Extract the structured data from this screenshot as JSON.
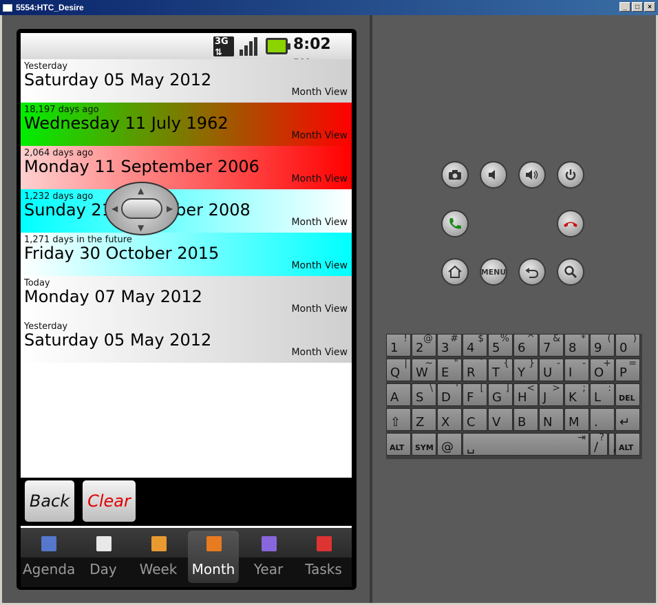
{
  "window": {
    "title": "5554:HTC_Desire",
    "btn_min": "_",
    "btn_max": "□",
    "btn_close": "×"
  },
  "status": {
    "network": "3G",
    "time": "8:02",
    "ampm": "PM"
  },
  "rows": [
    {
      "sub": "Yesterday",
      "date": "Saturday 05 May 2012",
      "link": "Month View",
      "bg": "linear-gradient(to right,#ffffff,#cfcfcf)"
    },
    {
      "sub": "18,197 days ago",
      "date": "Wednesday 11 July 1962",
      "link": "Month View",
      "bg": "linear-gradient(to right,#00ee00,#ff0000)"
    },
    {
      "sub": "2,064 days ago",
      "date": "Monday 11 September 2006",
      "link": "Month View",
      "bg": "linear-gradient(to right,#ffd0d0,#ff0000)"
    },
    {
      "sub": "1,232 days ago",
      "date": "Sunday 21 December 2008",
      "link": "Month View",
      "bg": "linear-gradient(to right,#00ffff,#ffffff)"
    },
    {
      "sub": "1,271 days in the future",
      "date": "Friday 30 October 2015",
      "link": "Month View",
      "bg": "linear-gradient(to right,#ffffff,#00ffff)"
    },
    {
      "sub": "Today",
      "date": "Monday 07 May 2012",
      "link": "Month View",
      "bg": "linear-gradient(to right,#ffffff,#cfcfcf)"
    },
    {
      "sub": "Yesterday",
      "date": "Saturday 05 May 2012",
      "link": "Month View",
      "bg": "linear-gradient(to right,#ffffff,#cfcfcf)"
    }
  ],
  "buttons": {
    "back": "Back",
    "clear": "Clear"
  },
  "tabs": [
    {
      "label": "Agenda",
      "icon": "agenda-icon",
      "color": "#5577cc"
    },
    {
      "label": "Day",
      "icon": "day-icon",
      "color": "#e8e8e8"
    },
    {
      "label": "Week",
      "icon": "week-icon",
      "color": "#e89a30"
    },
    {
      "label": "Month",
      "icon": "month-icon",
      "color": "#e87a20"
    },
    {
      "label": "Year",
      "icon": "year-icon",
      "color": "#8866dd"
    },
    {
      "label": "Tasks",
      "icon": "tasks-icon",
      "color": "#dd3333"
    }
  ],
  "active_tab": "Month",
  "controls": {
    "menu": "MENU",
    "icons": [
      "camera-icon",
      "volume-down-icon",
      "volume-up-icon",
      "power-icon",
      "call-icon",
      "end-call-icon",
      "home-icon",
      "back-arrow-icon",
      "search-icon"
    ]
  },
  "keyboard": {
    "row1": [
      [
        "1",
        "!"
      ],
      [
        "2",
        "@"
      ],
      [
        "3",
        "#"
      ],
      [
        "4",
        "$"
      ],
      [
        "5",
        "%"
      ],
      [
        "6",
        "^"
      ],
      [
        "7",
        "&"
      ],
      [
        "8",
        "*"
      ],
      [
        "9",
        "("
      ],
      [
        "0",
        ")"
      ]
    ],
    "row2": [
      [
        "Q",
        "|"
      ],
      [
        "W",
        "~"
      ],
      [
        "E",
        "\""
      ],
      [
        "R",
        "`"
      ],
      [
        "T",
        "{"
      ],
      [
        "Y",
        "}"
      ],
      [
        "U",
        "-"
      ],
      [
        "I",
        "-"
      ],
      [
        "O",
        "+"
      ],
      [
        "P",
        "="
      ]
    ],
    "row3": [
      [
        "A",
        ""
      ],
      [
        "S",
        "\\"
      ],
      [
        "D",
        "'"
      ],
      [
        "F",
        "["
      ],
      [
        "G",
        "]"
      ],
      [
        "H",
        "<"
      ],
      [
        "J",
        ">"
      ],
      [
        "K",
        ";"
      ],
      [
        "L",
        ":"
      ]
    ],
    "row4": [
      [
        "Z",
        ""
      ],
      [
        "X",
        ""
      ],
      [
        "C",
        ""
      ],
      [
        "V",
        ""
      ],
      [
        "B",
        ""
      ],
      [
        "N",
        ""
      ],
      [
        "M",
        ""
      ],
      [
        ".",
        ""
      ]
    ],
    "del": "DEL",
    "alt": "ALT",
    "sym": "SYM",
    "at": "@",
    "slash": "/",
    "question": "?",
    "comma": ","
  }
}
